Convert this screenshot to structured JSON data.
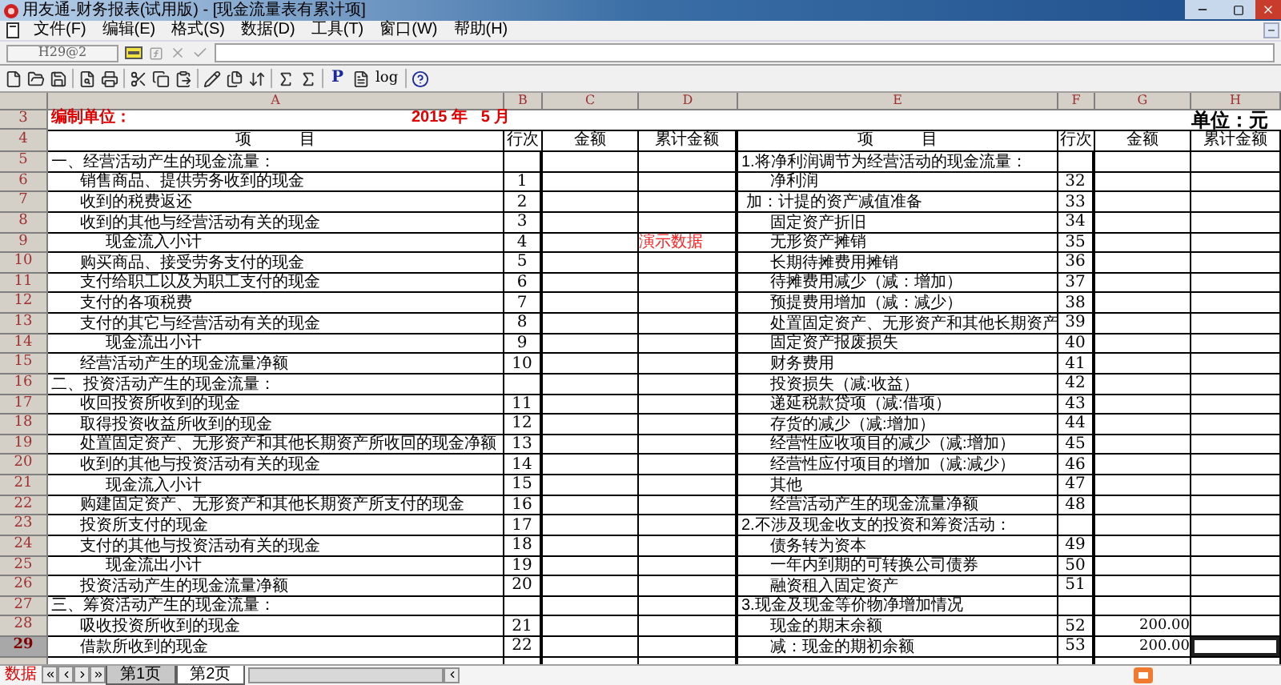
{
  "window": {
    "title": "用友通-财务报表(试用版) - [现金流量表有累计项]"
  },
  "menu": [
    "文件(F)",
    "编辑(E)",
    "格式(S)",
    "数据(D)",
    "工具(T)",
    "窗口(W)",
    "帮助(H)"
  ],
  "formula_bar": {
    "cell_name": "H29@2"
  },
  "toolbar": {
    "text_buttons": [
      "P",
      "log"
    ]
  },
  "columns": [
    "A",
    "B",
    "C",
    "D",
    "E",
    "F",
    "G",
    "H"
  ],
  "sheet": {
    "title_row": "3",
    "company_label": "编制单位：",
    "period": "2015 年   5 月",
    "unit": "单位：元",
    "header_row": "4",
    "headers": [
      "项　　　目",
      "行次",
      "金额",
      "累计金额",
      "项　　　目",
      "行次",
      "金额",
      "累计金额"
    ]
  },
  "rows": [
    {
      "row": "5",
      "selected": false,
      "left": {
        "kind": "section",
        "item": "一、经营活动产生的现金流量："
      },
      "right": {
        "kind": "section",
        "item": "1.将净利润调节为经营活动的现金流量："
      }
    },
    {
      "row": "6",
      "selected": false,
      "left": {
        "kind": "item",
        "item": "销售商品、提供劳务收到的现金",
        "line": "1"
      },
      "right": {
        "kind": "item",
        "item": "净利润",
        "line": "32"
      }
    },
    {
      "row": "7",
      "selected": false,
      "left": {
        "kind": "item",
        "item": "收到的税费返还",
        "line": "2"
      },
      "right": {
        "kind": "addition",
        "item": "加：计提的资产减值准备",
        "line": "33"
      }
    },
    {
      "row": "8",
      "selected": false,
      "left": {
        "kind": "item",
        "item": "收到的其他与经营活动有关的现金",
        "line": "3"
      },
      "right": {
        "kind": "item",
        "item": "固定资产折旧",
        "line": "34"
      }
    },
    {
      "row": "9",
      "selected": false,
      "left": {
        "kind": "subtotal",
        "item": "现金流入小计",
        "line": "4"
      },
      "note": "演示数据",
      "right": {
        "kind": "item",
        "item": "无形资产摊销",
        "line": "35"
      }
    },
    {
      "row": "10",
      "selected": false,
      "left": {
        "kind": "item",
        "item": "购买商品、接受劳务支付的现金",
        "line": "5"
      },
      "right": {
        "kind": "item",
        "item": "长期待摊费用摊销",
        "line": "36"
      }
    },
    {
      "row": "11",
      "selected": false,
      "left": {
        "kind": "item",
        "item": "支付给职工以及为职工支付的现金",
        "line": "6"
      },
      "right": {
        "kind": "item",
        "item": "待摊费用减少（减：增加）",
        "line": "37"
      }
    },
    {
      "row": "12",
      "selected": false,
      "left": {
        "kind": "item",
        "item": "支付的各项税费",
        "line": "7"
      },
      "right": {
        "kind": "item",
        "item": "预提费用增加（减：减少）",
        "line": "38"
      }
    },
    {
      "row": "13",
      "selected": false,
      "left": {
        "kind": "item",
        "item": "支付的其它与经营活动有关的现金",
        "line": "8"
      },
      "right": {
        "kind": "item",
        "item": "处置固定资产、无形资产和其他长期资产",
        "line": "39"
      }
    },
    {
      "row": "14",
      "selected": false,
      "left": {
        "kind": "subtotal",
        "item": "现金流出小计",
        "line": "9"
      },
      "right": {
        "kind": "item",
        "item": "固定资产报废损失",
        "line": "40"
      }
    },
    {
      "row": "15",
      "selected": false,
      "left": {
        "kind": "item",
        "item": "经营活动产生的现金流量净额",
        "line": "10"
      },
      "right": {
        "kind": "item",
        "item": "财务费用",
        "line": "41"
      }
    },
    {
      "row": "16",
      "selected": false,
      "left": {
        "kind": "section",
        "item": "二、投资活动产生的现金流量："
      },
      "right": {
        "kind": "item",
        "item": "投资损失（减:收益）",
        "line": "42"
      }
    },
    {
      "row": "17",
      "selected": false,
      "left": {
        "kind": "item",
        "item": "收回投资所收到的现金",
        "line": "11"
      },
      "right": {
        "kind": "item",
        "item": "递延税款贷项（减:借项）",
        "line": "43"
      }
    },
    {
      "row": "18",
      "selected": false,
      "left": {
        "kind": "item",
        "item": "取得投资收益所收到的现金",
        "line": "12"
      },
      "right": {
        "kind": "item",
        "item": "存货的减少（减:增加）",
        "line": "44"
      }
    },
    {
      "row": "19",
      "selected": false,
      "left": {
        "kind": "item",
        "item": "处置固定资产、无形资产和其他长期资产所收回的现金净额",
        "line": "13"
      },
      "right": {
        "kind": "item",
        "item": "经营性应收项目的减少（减:增加）",
        "line": "45"
      }
    },
    {
      "row": "20",
      "selected": false,
      "left": {
        "kind": "item",
        "item": "收到的其他与投资活动有关的现金",
        "line": "14"
      },
      "right": {
        "kind": "item",
        "item": "经营性应付项目的增加（减:减少）",
        "line": "46"
      }
    },
    {
      "row": "21",
      "selected": false,
      "left": {
        "kind": "subtotal",
        "item": "现金流入小计",
        "line": "15"
      },
      "right": {
        "kind": "item",
        "item": "其他",
        "line": "47"
      }
    },
    {
      "row": "22",
      "selected": false,
      "left": {
        "kind": "item",
        "item": "购建固定资产、无形资产和其他长期资产所支付的现金",
        "line": "16"
      },
      "right": {
        "kind": "item",
        "item": "经营活动产生的现金流量净额",
        "line": "48"
      }
    },
    {
      "row": "23",
      "selected": false,
      "left": {
        "kind": "item",
        "item": "投资所支付的现金",
        "line": "17"
      },
      "right": {
        "kind": "section",
        "item": "2.不涉及现金收支的投资和筹资活动："
      }
    },
    {
      "row": "24",
      "selected": false,
      "left": {
        "kind": "item",
        "item": "支付的其他与投资活动有关的现金",
        "line": "18"
      },
      "right": {
        "kind": "item",
        "item": "债务转为资本",
        "line": "49"
      }
    },
    {
      "row": "25",
      "selected": false,
      "left": {
        "kind": "subtotal",
        "item": "现金流出小计",
        "line": "19"
      },
      "right": {
        "kind": "item",
        "item": "一年内到期的可转换公司债券",
        "line": "50"
      }
    },
    {
      "row": "26",
      "selected": false,
      "left": {
        "kind": "item",
        "item": "投资活动产生的现金流量净额",
        "line": "20"
      },
      "right": {
        "kind": "item",
        "item": "融资租入固定资产",
        "line": "51"
      }
    },
    {
      "row": "27",
      "selected": false,
      "left": {
        "kind": "section",
        "item": "三、筹资活动产生的现金流量："
      },
      "right": {
        "kind": "section",
        "item": "3.现金及现金等价物净增加情况"
      }
    },
    {
      "row": "28",
      "selected": false,
      "left": {
        "kind": "item",
        "item": "吸收投资所收到的现金",
        "line": "21"
      },
      "right": {
        "kind": "item",
        "item": "现金的期末余额",
        "line": "52",
        "amount": "200.00"
      }
    },
    {
      "row": "29",
      "selected": true,
      "left": {
        "kind": "item",
        "item": "借款所收到的现金",
        "line": "22"
      },
      "right": {
        "kind": "item",
        "item": "减：现金的期初余额",
        "line": "53",
        "amount": "200.00"
      }
    }
  ],
  "sheet_tabs": {
    "label": "数据",
    "tabs": [
      {
        "label": "第1页",
        "selected": false
      },
      {
        "label": "第2页",
        "selected": true
      }
    ]
  }
}
